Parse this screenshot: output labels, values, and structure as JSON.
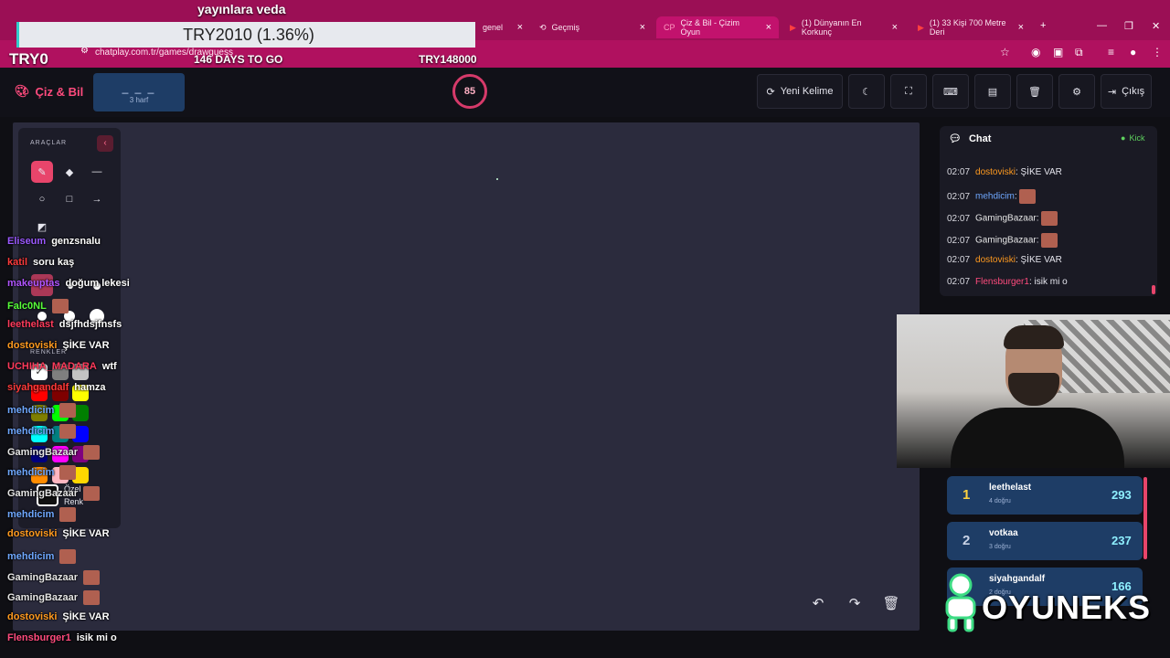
{
  "overlay": {
    "title": "yayınlara veda",
    "progress_text": "TRY2010 (1.36%)",
    "progress_fraction": 0.0136,
    "left_label": "TRY0",
    "days": "146 DAYS TO GO",
    "goal": "TRY148000"
  },
  "browser": {
    "tabs": [
      {
        "label": "genel",
        "active": false
      },
      {
        "label": "Geçmiş",
        "active": false
      },
      {
        "label": "Çiz & Bil - Çizim Oyun",
        "active": true
      },
      {
        "label": "(1) Dünyanın En Korkunç",
        "active": false
      },
      {
        "label": "(1) 33 Kişi 700 Metre Deri",
        "active": false
      }
    ],
    "url": "chatplay.com.tr/games/drawguess"
  },
  "header": {
    "brand": "Çiz & Bil",
    "word_mask": "_ _ _",
    "word_hint": "3 harf",
    "timer": "85",
    "new_word": "Yeni Kelime",
    "exit": "Çıkış"
  },
  "tools": {
    "title": "ARAÇLAR",
    "colors_title": "RENKLER",
    "custom_label_1": "Özel",
    "custom_label_2": "Renk",
    "palette": [
      "#ffffff",
      "#7f7f7f",
      "#c3c3c3",
      "#ff0000",
      "#7f0000",
      "#ffff00",
      "#7f7f00",
      "#00ff00",
      "#007f00",
      "#00ffff",
      "#007f7f",
      "#0000ff",
      "#00007f",
      "#ff00ff",
      "#7f007f",
      "#ff8c00",
      "#ffb6c1",
      "#ffd700"
    ]
  },
  "overlay_chat": [
    {
      "user": "Eliseum",
      "color": "#9b59ff",
      "msg": "genzsnalu",
      "emote": false
    },
    {
      "user": "katil",
      "color": "#ff3b3b",
      "msg": "soru kaş",
      "emote": false
    },
    {
      "user": "makeuptas",
      "color": "#b055ff",
      "msg": "doğum lekesi",
      "emote": false
    },
    {
      "user": "Falc0NL",
      "color": "#57ff3a",
      "msg": "",
      "emote": true
    },
    {
      "user": "leethelast",
      "color": "#ff3b5c",
      "msg": "dsjfhdsjfnsfs",
      "emote": false
    },
    {
      "user": "dostoviski",
      "color": "#ff9a1f",
      "msg": "ŞİKE VAR",
      "emote": false
    },
    {
      "user": "UCHIHA_MADARA",
      "color": "#ff3b5c",
      "msg": "wtf",
      "emote": false
    },
    {
      "user": "siyahgandalf",
      "color": "#ff3b3b",
      "msg": "hamza",
      "emote": false
    },
    {
      "user": "mehdicim",
      "color": "#6fa8ff",
      "msg": "",
      "emote": true
    },
    {
      "user": "mehdicim",
      "color": "#6fa8ff",
      "msg": "",
      "emote": true
    },
    {
      "user": "GamingBazaar",
      "color": "#e6e6e6",
      "msg": "",
      "emote": true
    },
    {
      "user": "mehdicim",
      "color": "#6fa8ff",
      "msg": "",
      "emote": true
    },
    {
      "user": "GamingBazaar",
      "color": "#e6e6e6",
      "msg": "",
      "emote": true
    },
    {
      "user": "mehdicim",
      "color": "#6fa8ff",
      "msg": "",
      "emote": true
    },
    {
      "user": "dostoviski",
      "color": "#ff9a1f",
      "msg": "ŞİKE VAR",
      "emote": false
    },
    {
      "user": "mehdicim",
      "color": "#6fa8ff",
      "msg": "",
      "emote": true
    },
    {
      "user": "GamingBazaar",
      "color": "#e6e6e6",
      "msg": "",
      "emote": true
    },
    {
      "user": "GamingBazaar",
      "color": "#e6e6e6",
      "msg": "",
      "emote": true
    },
    {
      "user": "dostoviski",
      "color": "#ff9a1f",
      "msg": "ŞİKE VAR",
      "emote": false
    },
    {
      "user": "Flensburger1",
      "color": "#ff4b7d",
      "msg": "isik mi o",
      "emote": false
    }
  ],
  "chat": {
    "title": "Chat",
    "kick": "Kick",
    "messages": [
      {
        "time": "02:07",
        "user": "dostoviski",
        "color": "#ff9a1f",
        "msg": "ŞİKE VAR",
        "emote": false
      },
      {
        "time": "02:07",
        "user": "mehdicim",
        "color": "#6fa8ff",
        "msg": "",
        "emote": true
      },
      {
        "time": "02:07",
        "user": "GamingBazaar",
        "color": "#e6e6e6",
        "msg": "",
        "emote": true
      },
      {
        "time": "02:07",
        "user": "GamingBazaar",
        "color": "#e6e6e6",
        "msg": "",
        "emote": true
      },
      {
        "time": "02:07",
        "user": "dostoviski",
        "color": "#ff9a1f",
        "msg": "ŞİKE VAR",
        "emote": false
      },
      {
        "time": "02:07",
        "user": "Flensburger1",
        "color": "#ff4b7d",
        "msg": "isik mi o",
        "emote": false
      }
    ]
  },
  "leaderboard": [
    {
      "rank": "1",
      "name": "leethelast",
      "sub": "4 doğru",
      "score": "293",
      "rank_color": "#ffd23f"
    },
    {
      "rank": "2",
      "name": "votkaa",
      "sub": "3 doğru",
      "score": "237",
      "rank_color": "#c9d3e6"
    },
    {
      "rank": "3",
      "name": "siyahgandalf",
      "sub": "2 doğru",
      "score": "166",
      "rank_color": "#d89a5a"
    }
  ],
  "logo": "OYUNEKS"
}
